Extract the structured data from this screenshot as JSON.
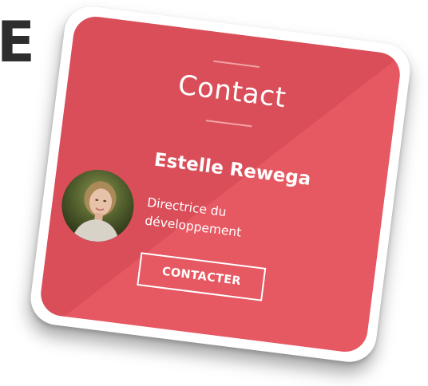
{
  "background_letter": "E",
  "contact_card": {
    "title": "Contact",
    "person": {
      "name": "Estelle Rewega",
      "role": "Directrice du développement",
      "avatar": "portrait-photo"
    },
    "button_label": "CONTACTER"
  },
  "colors": {
    "card_red": "#d94e59",
    "card_red_light": "#e65862",
    "rule": "#f3a3a9",
    "text": "#ffffff",
    "letter": "#2d2d2d"
  }
}
